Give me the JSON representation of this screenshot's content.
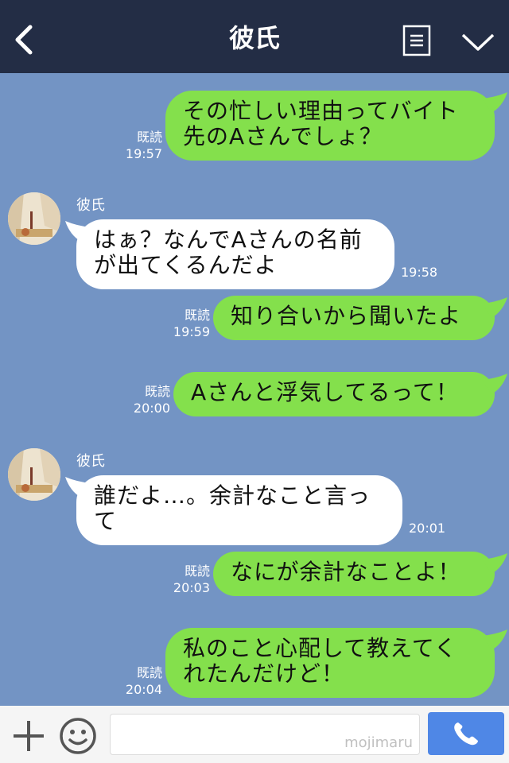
{
  "header": {
    "title": "彼氏"
  },
  "messages": [
    {
      "dir": "out",
      "text": "その忙しい理由ってバイト\n先のAさんでしょ？",
      "read": "既読",
      "time": "19:57"
    },
    {
      "dir": "in",
      "sender": "彼氏",
      "text": "はぁ？なんでAさんの名前\nが出てくるんだよ",
      "time": "19:58"
    },
    {
      "dir": "out",
      "text": "知り合いから聞いたよ",
      "read": "既読",
      "time": "19:59"
    },
    {
      "dir": "out",
      "text": "Aさんと浮気してるって！",
      "read": "既読",
      "time": "20:00"
    },
    {
      "dir": "in",
      "sender": "彼氏",
      "text": "誰だよ…。余計なこと言っ\nて",
      "time": "20:01"
    },
    {
      "dir": "out",
      "text": "なにが余計なことよ！",
      "read": "既読",
      "time": "20:03"
    },
    {
      "dir": "out",
      "text": "私のこと心配して教えてく\nれたんだけど！",
      "read": "既読",
      "time": "20:04"
    }
  ],
  "footer": {
    "input_value": "",
    "watermark": "mojimaru"
  },
  "colors": {
    "header": "#232d45",
    "chat_bg": "#7394c4",
    "out_bubble": "#84e04c",
    "in_bubble": "#ffffff",
    "send": "#4f87e6"
  }
}
